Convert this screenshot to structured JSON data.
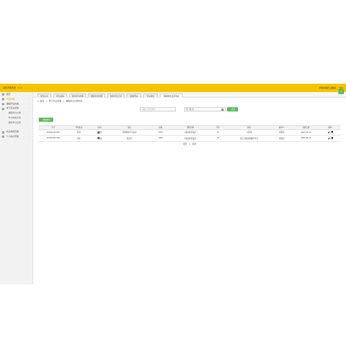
{
  "app": {
    "title": "高校学籍系统",
    "version": "v1.0",
    "user_label": "学院管理员 金融系",
    "user_menu": "退出"
  },
  "sidebar": {
    "items": [
      {
        "label": "首页",
        "icon": "home-icon",
        "active": false,
        "sub": false
      },
      {
        "label": "学生管理",
        "icon": "user-icon",
        "active": true,
        "sub": false,
        "arrow": "›"
      },
      {
        "label": "课程开班管理",
        "icon": "book-icon",
        "active": false,
        "sub": false,
        "arrow": "›"
      },
      {
        "label": "学习专业管理",
        "icon": "folder-icon",
        "active": false,
        "sub": false,
        "arrow": "⌄"
      },
      {
        "label": "课程学分记录",
        "active": false,
        "sub": true
      },
      {
        "label": "学分成绩记录",
        "active": false,
        "sub": true
      },
      {
        "label": "课外学分记录",
        "active": false,
        "sub": true
      },
      {
        "label": "",
        "active": false,
        "sub": true
      },
      {
        "label": "毕业审核管理",
        "icon": "check-icon",
        "active": false,
        "sub": false,
        "arrow": "›"
      },
      {
        "label": "个人信息管理",
        "icon": "id-icon",
        "active": false,
        "sub": false,
        "arrow": "›"
      }
    ]
  },
  "tabs": [
    {
      "label": "学生信息",
      "active": false
    },
    {
      "label": "学生成绩",
      "active": false
    },
    {
      "label": "课外学分管理",
      "active": false
    },
    {
      "label": "课程学分管理",
      "active": false
    },
    {
      "label": "课外学分记录",
      "active": false
    },
    {
      "label": "课程开班",
      "active": false
    },
    {
      "label": "毕业审核",
      "active": false
    },
    {
      "label": "课程学分记录列表",
      "active": true
    }
  ],
  "corner_button": "⟳",
  "breadcrumb": [
    "首页",
    ">",
    "学习专业管理",
    ">",
    "课程学分记录列表"
  ],
  "search": {
    "placeholder": "请输入学生学号",
    "date_value": "年 /月/日",
    "search_label": "搜索"
  },
  "add_button": "添加学分",
  "table": {
    "headers": [
      "学号",
      "学生姓名",
      "性别",
      "专业",
      "班级",
      "课程名称",
      "学分",
      "备注",
      "操作人",
      "创建日期",
      "操作"
    ],
    "rows": [
      [
        "201810457051",
        "陈星",
        "男",
        "计算机科学与技术",
        "1801",
        "C语言程序设计",
        "30",
        "无扩展",
        "张晓英",
        "2022-05-14",
        ""
      ],
      [
        "201810457052",
        "李红",
        "女",
        "会计学",
        "1802",
        "C语言程序设计",
        "30",
        "第三方外语的数学学习",
        "张晓英",
        "2022-05-14",
        ""
      ]
    ]
  },
  "pager": [
    "首页",
    "1",
    "尾页"
  ]
}
